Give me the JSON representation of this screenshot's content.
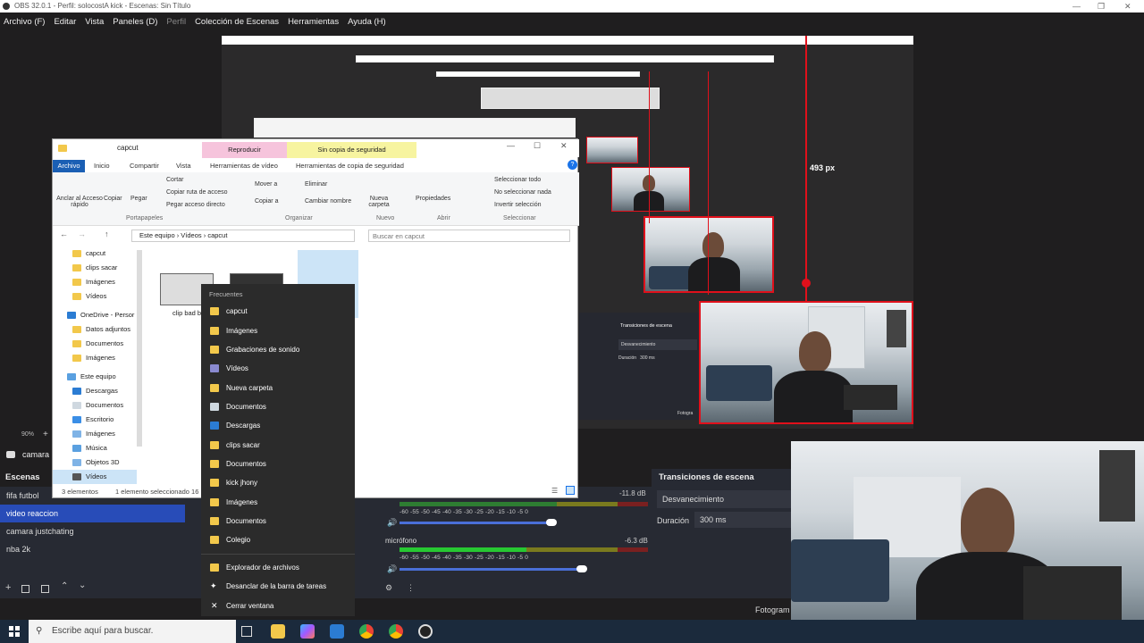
{
  "obs": {
    "title": "OBS 32.0.1 - Perfil: solocostA kick - Escenas: Sin Título",
    "menu": [
      "Archivo (F)",
      "Editar",
      "Vista",
      "Paneles (D)",
      "Perfil",
      "Colección de Escenas",
      "Herramientas",
      "Ayuda (H)"
    ],
    "preview_measure": "493 px",
    "zoom": "90%",
    "source_toolbar_label": "camara",
    "scenes_title": "Escenas",
    "scenes": [
      "fifa futbol",
      "video reaccion",
      "camara justchating",
      "nba 2k"
    ],
    "selected_scene": "video reaccion",
    "transitions_title": "Transiciones de escena",
    "transition_value": "Desvanecimiento",
    "duration_label": "Duración",
    "duration_value": "300 ms",
    "mixer": {
      "track1_db": "-11.8 dB",
      "track2_name": "micrófono",
      "track2_db": "-6.3 dB",
      "ticks": "-60  -55  -50  -45  -40  -35  -30  -25  -20  -15  -10   -5    0"
    },
    "status_label": "Fotogram"
  },
  "explorer": {
    "title": "capcut",
    "context_tab1": "Reproducir",
    "context_tab2": "Sin copia de seguridad",
    "tabs": [
      "Archivo",
      "Inicio",
      "Compartir",
      "Vista",
      "Herramientas de vídeo",
      "Herramientas de copia de seguridad"
    ],
    "ribbon": {
      "pin": "Anclar al Acceso rápido",
      "copy": "Copiar",
      "paste": "Pegar",
      "cut": "Cortar",
      "copy_path": "Copiar ruta de acceso",
      "paste_shortcut": "Pegar acceso directo",
      "group_clipboard": "Portapapeles",
      "move_to": "Mover a",
      "copy_to": "Copiar a",
      "delete": "Eliminar",
      "rename": "Cambiar nombre",
      "group_organize": "Organizar",
      "new_folder": "Nueva carpeta",
      "group_new": "Nuevo",
      "properties": "Propiedades",
      "group_open": "Abrir",
      "select_all": "Seleccionar todo",
      "select_none": "No seleccionar nada",
      "invert": "Invertir selección",
      "group_select": "Seleccionar"
    },
    "breadcrumb": [
      "Este equipo",
      "Vídeos",
      "capcut"
    ],
    "search_placeholder": "Buscar en capcut",
    "nav": [
      "capcut",
      "clips sacar",
      "Imágenes",
      "Vídeos",
      "OneDrive - Persor",
      "Datos adjuntos",
      "Documentos",
      "Imágenes",
      "Este equipo",
      "Descargas",
      "Documentos",
      "Escritorio",
      "Imágenes",
      "Música",
      "Objetos 3D",
      "Vídeos"
    ],
    "file_label": "clip bad b",
    "status_count": "3 elementos",
    "status_selected": "1 elemento seleccionado  16"
  },
  "jumplist": {
    "header": "Frecuentes",
    "items": [
      "capcut",
      "Imágenes",
      "Grabaciones de sonido",
      "Vídeos",
      "Nueva carpeta",
      "Documentos",
      "Descargas",
      "clips sacar",
      "Documentos",
      "kick jhony",
      "Imágenes",
      "Documentos",
      "Colegio"
    ],
    "actions": [
      "Explorador de archivos",
      "Desanclar de la barra de tareas",
      "Cerrar ventana"
    ]
  },
  "taskbar": {
    "search_placeholder": "Escribe aquí para buscar."
  },
  "colors": {
    "selection": "#284cb8",
    "red_guide": "#e0101b",
    "folder": "#f2c84b",
    "context_pink": "#f6c4dc",
    "context_yellow": "#f7f4a0"
  }
}
